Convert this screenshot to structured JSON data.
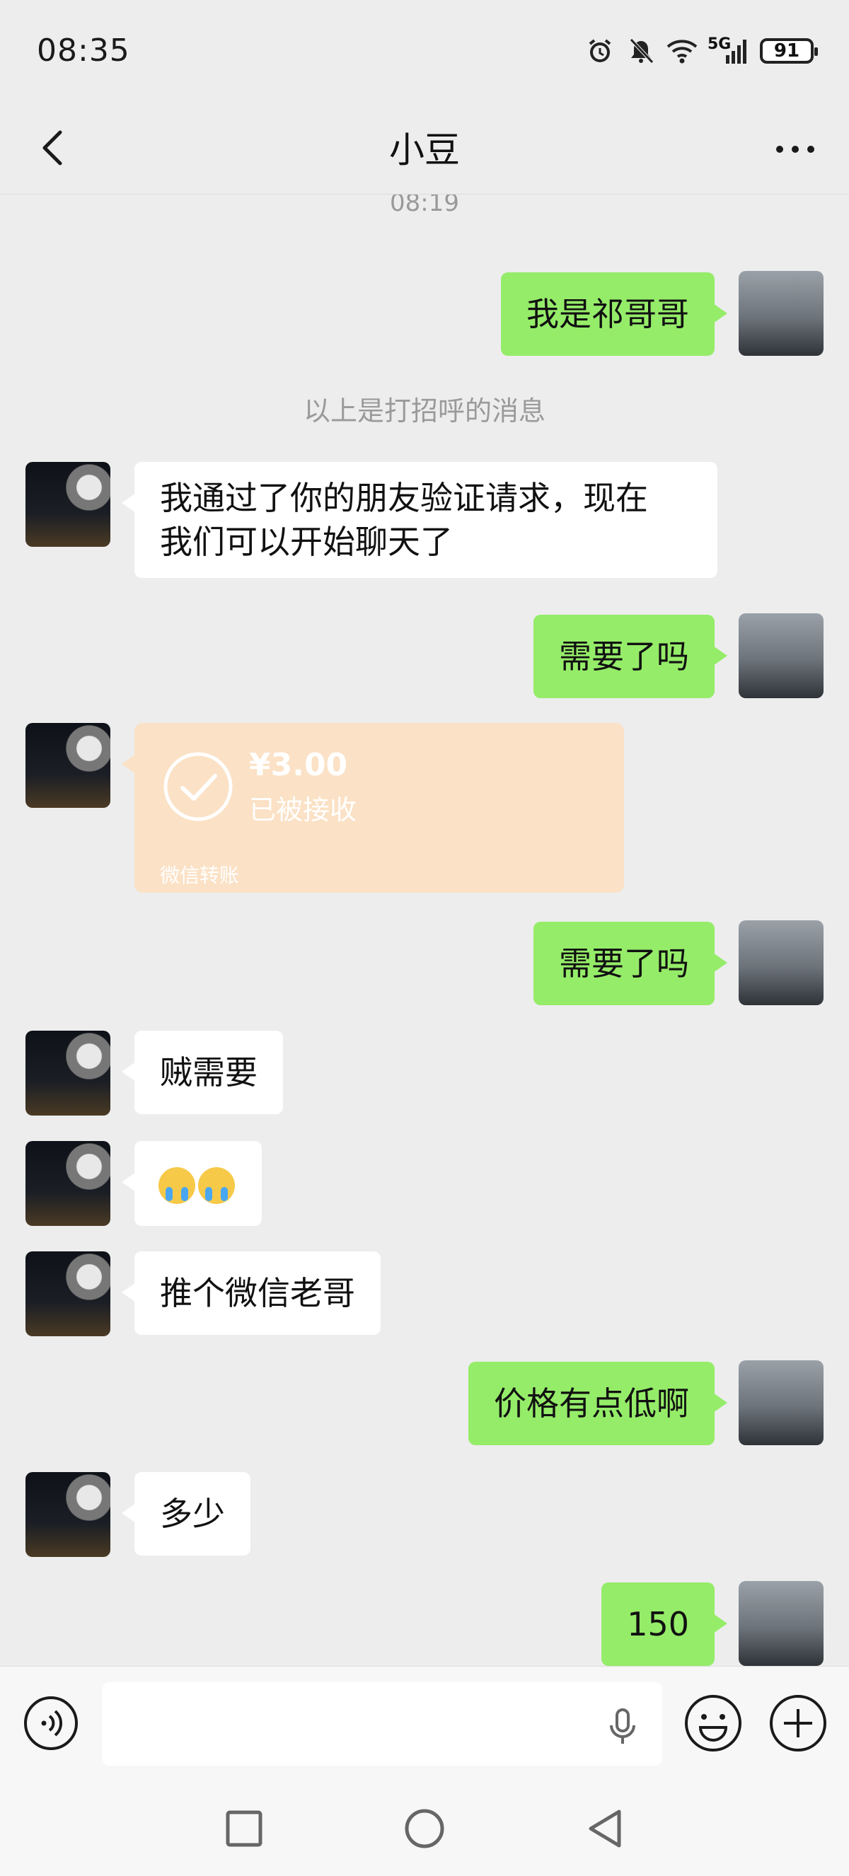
{
  "status_bar": {
    "time": "08:35",
    "network": "5G",
    "battery": "91"
  },
  "header": {
    "title": "小豆"
  },
  "chat": {
    "timestamp": "08:19",
    "system_message": "以上是打招呼的消息",
    "messages": [
      {
        "from": "me",
        "text": "我是祁哥哥"
      },
      {
        "from": "other",
        "text_line1": "我通过了你的朋友验证请求，现在",
        "text_line2": "我们可以开始聊天了"
      },
      {
        "from": "me",
        "text": "需要了吗"
      },
      {
        "from": "other",
        "type": "transfer",
        "amount": "¥3.00",
        "status": "已被接收",
        "label": "微信转账"
      },
      {
        "from": "me",
        "text": "需要了吗"
      },
      {
        "from": "other",
        "text": "贼需要"
      },
      {
        "from": "other",
        "type": "emoji",
        "emoji_name": "crying-face-emoji"
      },
      {
        "from": "other",
        "text": "推个微信老哥"
      },
      {
        "from": "me",
        "text": "价格有点低啊"
      },
      {
        "from": "other",
        "text": "多少"
      },
      {
        "from": "me",
        "text": "150"
      }
    ]
  },
  "input_bar": {
    "message_value": ""
  },
  "colors": {
    "my_bubble": "#95ec69",
    "other_bubble": "#ffffff",
    "transfer_card": "#fbe1c5",
    "background": "#ededed"
  }
}
